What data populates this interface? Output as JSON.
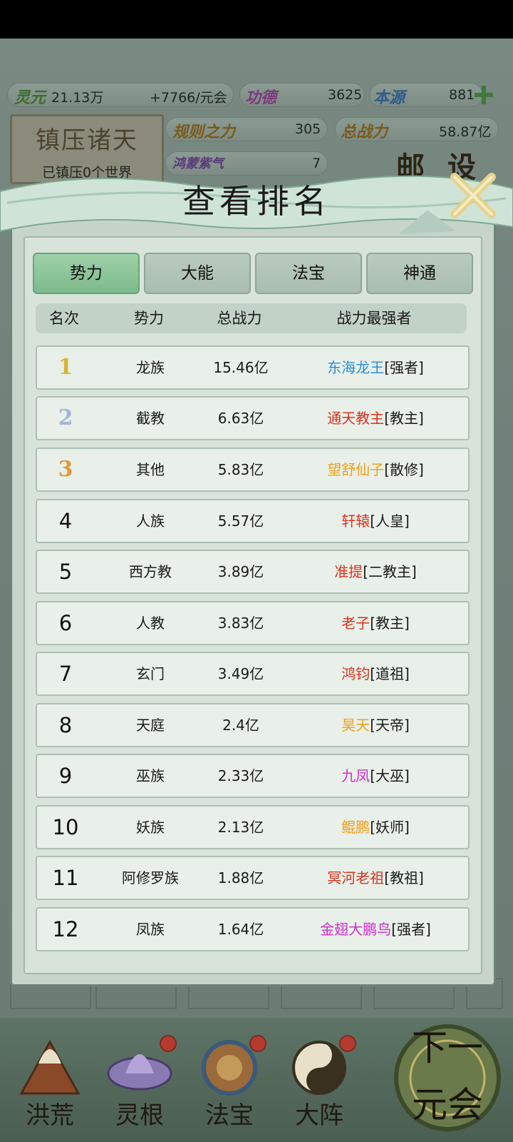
{
  "resources": {
    "lingyuan_label": "灵元",
    "lingyuan_value": "21.13万",
    "lingyuan_rate": "+7766/元会",
    "gongde_label": "功德",
    "gongde_value": "3625",
    "benyuan_label": "本源",
    "benyuan_value": "881",
    "guize_label": "规则之力",
    "guize_value": "305",
    "zongzhanli_label": "总战力",
    "zongzhanli_value": "58.87亿",
    "hongmeng_label": "鸿蒙紫气",
    "hongmeng_value": "7"
  },
  "board": {
    "title": "镇压诸天",
    "subtitle": "已镇压0个世界"
  },
  "side_buttons": {
    "mail": "邮",
    "settings": "设"
  },
  "dialog": {
    "title": "查看排名",
    "tabs": [
      {
        "label": "势力",
        "active": true
      },
      {
        "label": "大能",
        "active": false
      },
      {
        "label": "法宝",
        "active": false
      },
      {
        "label": "神通",
        "active": false
      }
    ],
    "headers": {
      "rank": "名次",
      "faction": "势力",
      "power": "总战力",
      "strongest": "战力最强者"
    },
    "rows": [
      {
        "rank": "1",
        "faction": "龙族",
        "power": "15.46亿",
        "name": "东海龙王",
        "title": "[强者]",
        "name_color": "#2a8fd8"
      },
      {
        "rank": "2",
        "faction": "截教",
        "power": "6.63亿",
        "name": "通天教主",
        "title": "[教主]",
        "name_color": "#e0321e"
      },
      {
        "rank": "3",
        "faction": "其他",
        "power": "5.83亿",
        "name": "望舒仙子",
        "title": "[散修]",
        "name_color": "#f0a018"
      },
      {
        "rank": "4",
        "faction": "人族",
        "power": "5.57亿",
        "name": "轩辕",
        "title": "[人皇]",
        "name_color": "#e0321e"
      },
      {
        "rank": "5",
        "faction": "西方教",
        "power": "3.89亿",
        "name": "准提",
        "title": "[二教主]",
        "name_color": "#e0321e"
      },
      {
        "rank": "6",
        "faction": "人教",
        "power": "3.83亿",
        "name": "老子",
        "title": "[教主]",
        "name_color": "#e0321e"
      },
      {
        "rank": "7",
        "faction": "玄门",
        "power": "3.49亿",
        "name": "鸿钧",
        "title": "[道祖]",
        "name_color": "#e0321e"
      },
      {
        "rank": "8",
        "faction": "天庭",
        "power": "2.4亿",
        "name": "昊天",
        "title": "[天帝]",
        "name_color": "#f0a018"
      },
      {
        "rank": "9",
        "faction": "巫族",
        "power": "2.33亿",
        "name": "九凤",
        "title": "[大巫]",
        "name_color": "#d42ad4"
      },
      {
        "rank": "10",
        "faction": "妖族",
        "power": "2.13亿",
        "name": "鲲鹏",
        "title": "[妖师]",
        "name_color": "#f0a018"
      },
      {
        "rank": "11",
        "faction": "阿修罗族",
        "power": "1.88亿",
        "name": "冥河老祖",
        "title": "[教祖]",
        "name_color": "#e0321e"
      },
      {
        "rank": "12",
        "faction": "凤族",
        "power": "1.64亿",
        "name": "金翅大鹏鸟",
        "title": "[强者]",
        "name_color": "#d42ad4"
      }
    ]
  },
  "bottom_nav": [
    {
      "label": "洪荒",
      "badge": false
    },
    {
      "label": "灵根",
      "badge": true
    },
    {
      "label": "法宝",
      "badge": true
    },
    {
      "label": "大阵",
      "badge": true
    }
  ],
  "next_button": {
    "line1": "下一",
    "line2": "元会"
  },
  "colors": {
    "rank1": "#d8b436",
    "rank2": "#a6b4d8",
    "rank3": "#e0983c"
  }
}
